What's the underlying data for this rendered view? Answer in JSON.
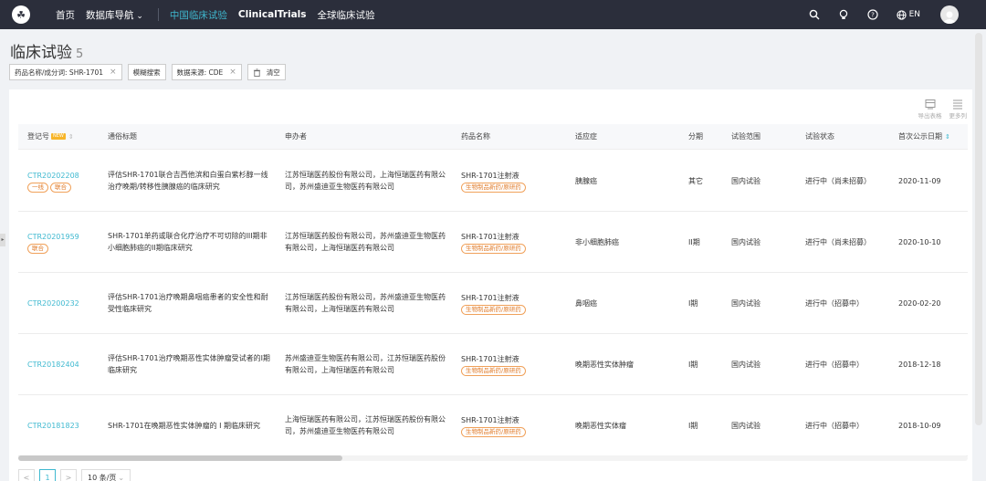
{
  "nav": {
    "logo": "☘",
    "items": [
      {
        "label": "首页"
      },
      {
        "label": "数据库导航"
      }
    ],
    "sub_items": [
      {
        "label": "中国临床试验"
      },
      {
        "label": "ClinicalTrials"
      },
      {
        "label": "全球临床试验"
      }
    ],
    "lang": "EN"
  },
  "header": {
    "title": "临床试验",
    "count": "5"
  },
  "filters": {
    "drug": "药品名称/成分词: SHR-1701",
    "fuzzy": "模糊搜索",
    "source": "数据来源: CDE",
    "clear": "清空",
    "remove": "×"
  },
  "card_tools": {
    "export": "导出表格",
    "more_cols": "更多列"
  },
  "table": {
    "headers": {
      "reg_no": "登记号",
      "new_tag": "NEW",
      "title": "通俗标题",
      "sponsor": "申办者",
      "drug": "药品名称",
      "indication": "适应症",
      "phase": "分期",
      "scope": "试验范围",
      "status": "试验状态",
      "date": "首次公示日期"
    },
    "rows": [
      {
        "reg_no": "CTR20202208",
        "tags": [
          "一线",
          "联合"
        ],
        "title": "评估SHR-1701联合吉西他滨和白蛋白紫杉醇一线治疗晚期/转移性胰腺癌的临床研究",
        "sponsor": "江苏恒瑞医药股份有限公司，上海恒瑞医药有限公司，苏州盛迪亚生物医药有限公司",
        "drug": "SHR-1701注射液",
        "drug_tag": "生物制品新药/原研药",
        "indication": "胰腺癌",
        "phase": "其它",
        "scope": "国内试验",
        "status": "进行中（尚未招募）",
        "date": "2020-11-09"
      },
      {
        "reg_no": "CTR20201959",
        "tags": [
          "联合"
        ],
        "title": "SHR-1701单药或联合化疗治疗不可切除的III期非小细胞肺癌的II期临床研究",
        "sponsor": "江苏恒瑞医药股份有限公司，苏州盛迪亚生物医药有限公司，上海恒瑞医药有限公司",
        "drug": "SHR-1701注射液",
        "drug_tag": "生物制品新药/原研药",
        "indication": "非小细胞肺癌",
        "phase": "II期",
        "scope": "国内试验",
        "status": "进行中（尚未招募）",
        "date": "2020-10-10"
      },
      {
        "reg_no": "CTR20200232",
        "tags": [],
        "title": "评估SHR-1701治疗晚期鼻咽癌患者的安全性和耐受性临床研究",
        "sponsor": "江苏恒瑞医药股份有限公司，苏州盛迪亚生物医药有限公司，上海恒瑞医药有限公司",
        "drug": "SHR-1701注射液",
        "drug_tag": "生物制品新药/原研药",
        "indication": "鼻咽癌",
        "phase": "I期",
        "scope": "国内试验",
        "status": "进行中（招募中）",
        "date": "2020-02-20"
      },
      {
        "reg_no": "CTR20182404",
        "tags": [],
        "title": "评估SHR-1701治疗晚期恶性实体肿瘤受试者的I期临床研究",
        "sponsor": "苏州盛迪亚生物医药有限公司，江苏恒瑞医药股份有限公司，上海恒瑞医药有限公司",
        "drug": "SHR-1701注射液",
        "drug_tag": "生物制品新药/原研药",
        "indication": "晚期恶性实体肿瘤",
        "phase": "I期",
        "scope": "国内试验",
        "status": "进行中（招募中）",
        "date": "2018-12-18"
      },
      {
        "reg_no": "CTR20181823",
        "tags": [],
        "title": "SHR-1701在晚期恶性实体肿瘤的 I 期临床研究",
        "sponsor": "上海恒瑞医药有限公司，江苏恒瑞医药股份有限公司，苏州盛迪亚生物医药有限公司",
        "drug": "SHR-1701注射液",
        "drug_tag": "生物制品新药/原研药",
        "indication": "晚期恶性实体瘤",
        "phase": "I期",
        "scope": "国内试验",
        "status": "进行中（招募中）",
        "date": "2018-10-09"
      }
    ]
  },
  "pager": {
    "prev": "<",
    "page": "1",
    "next": ">",
    "size": "10 条/页"
  },
  "side_toggle": "▸"
}
